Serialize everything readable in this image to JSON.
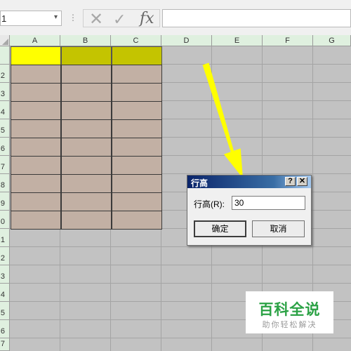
{
  "formula_bar": {
    "name_box_value": "1",
    "name_box_arrow": "▾",
    "separator": "⋮",
    "cancel_glyph": "✕",
    "enter_glyph": "✓",
    "fx_label": "fx",
    "formula_value": ""
  },
  "sheet": {
    "columns": [
      "A",
      "B",
      "C",
      "D",
      "E",
      "F",
      "G"
    ],
    "rows": [
      "",
      "2",
      "3",
      "4",
      "5",
      "6",
      "7",
      "8",
      "9",
      "0",
      "1",
      "2",
      "3",
      "4",
      "5",
      "6",
      "7"
    ],
    "header_fill_colors": [
      "#ffff00",
      "#c4c400",
      "#c4c400"
    ],
    "body_fill_color": "#c2b0a4"
  },
  "dialog": {
    "title": "行高",
    "help_label": "?",
    "close_label": "✕",
    "row_height_label": "行高(R):",
    "row_height_value": "30",
    "ok_label": "确定",
    "cancel_label": "取消"
  },
  "watermark": {
    "main": "百科全说",
    "sub": "助你轻松解决"
  },
  "annotation": {
    "arrow_color": "#ffff00"
  }
}
